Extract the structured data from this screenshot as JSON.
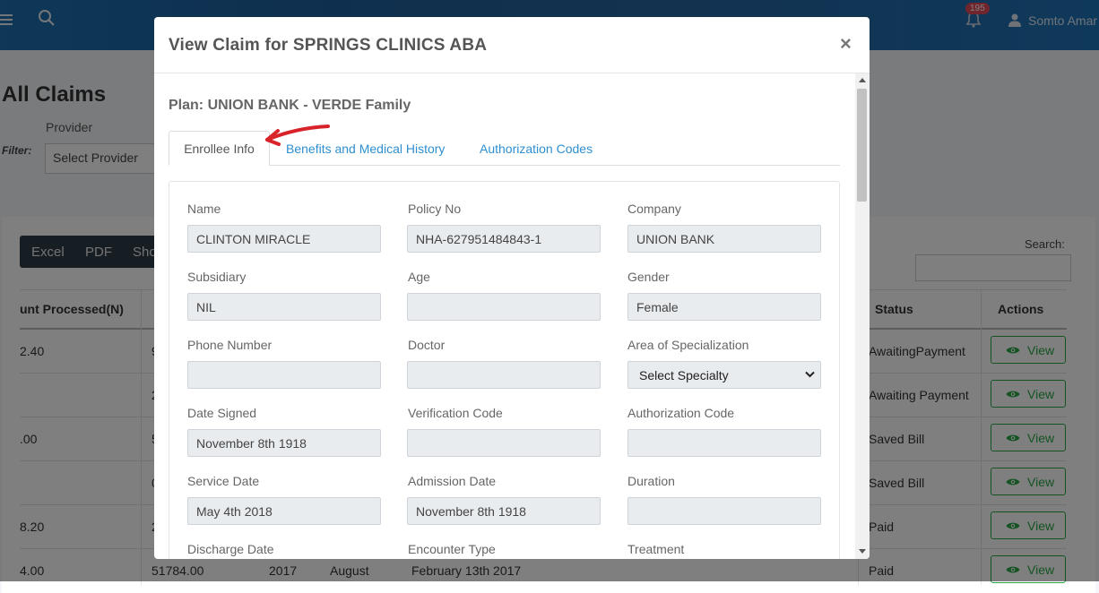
{
  "header": {
    "notification_count": "195",
    "user_name": "Somto Amar"
  },
  "page": {
    "title": "All Claims",
    "provider_label": "Provider",
    "filter_label": "Filter:",
    "provider_select": "Select Provider",
    "export_buttons": [
      "Excel",
      "PDF",
      "Sho"
    ],
    "search_label": "Search:"
  },
  "table": {
    "headers": {
      "amount": "unt Processed(N)",
      "status": "Status",
      "actions": "Actions"
    },
    "rows": [
      {
        "amount": "2.40",
        "c2": "9",
        "status": "AwaitingPayment",
        "action": "View"
      },
      {
        "amount": "",
        "c2": "2",
        "status": "Awaiting Payment",
        "action": "View"
      },
      {
        "amount": ".00",
        "c2": "5",
        "status": "Saved Bill",
        "action": "View"
      },
      {
        "amount": "",
        "c2": "0",
        "status": "Saved Bill",
        "action": "View"
      },
      {
        "amount": "8.20",
        "c2": "2",
        "status": "Paid",
        "action": "View"
      },
      {
        "amount": "4.00",
        "c2": "51784.00",
        "year": "2017",
        "month": "August",
        "date": "February 13th 2017",
        "status": "Paid",
        "action": "View"
      }
    ]
  },
  "modal": {
    "title": "View Claim for SPRINGS CLINICS ABA",
    "close": "×",
    "plan": "Plan: UNION BANK - VERDE Family",
    "tabs": [
      "Enrollee Info",
      "Benefits and Medical History",
      "Authorization Codes"
    ],
    "fields": {
      "name": {
        "label": "Name",
        "value": "CLINTON MIRACLE"
      },
      "policy_no": {
        "label": "Policy No",
        "value": "NHA-627951484843-1"
      },
      "company": {
        "label": "Company",
        "value": "UNION BANK"
      },
      "subsidiary": {
        "label": "Subsidiary",
        "value": "NIL"
      },
      "age": {
        "label": "Age",
        "value": ""
      },
      "gender": {
        "label": "Gender",
        "value": "Female"
      },
      "phone": {
        "label": "Phone Number",
        "value": ""
      },
      "doctor": {
        "label": "Doctor",
        "value": ""
      },
      "specialization": {
        "label": "Area of Specialization",
        "value": "Select Specialty"
      },
      "date_signed": {
        "label": "Date Signed",
        "value": "November 8th 1918"
      },
      "verification_code": {
        "label": "Verification Code",
        "value": ""
      },
      "authorization_code": {
        "label": "Authorization Code",
        "value": ""
      },
      "service_date": {
        "label": "Service Date",
        "value": "May 4th 2018"
      },
      "admission_date": {
        "label": "Admission Date",
        "value": "November 8th 1918"
      },
      "duration": {
        "label": "Duration",
        "value": ""
      },
      "discharge_date": {
        "label": "Discharge Date"
      },
      "encounter_type": {
        "label": "Encounter Type"
      },
      "treatment": {
        "label": "Treatment"
      }
    }
  },
  "colors": {
    "header_blue": "#1e6aa8",
    "link_blue": "#2f8fd0",
    "success_green": "#28a745",
    "badge_red": "#e04b5a",
    "annotation_red": "#d9232a"
  }
}
